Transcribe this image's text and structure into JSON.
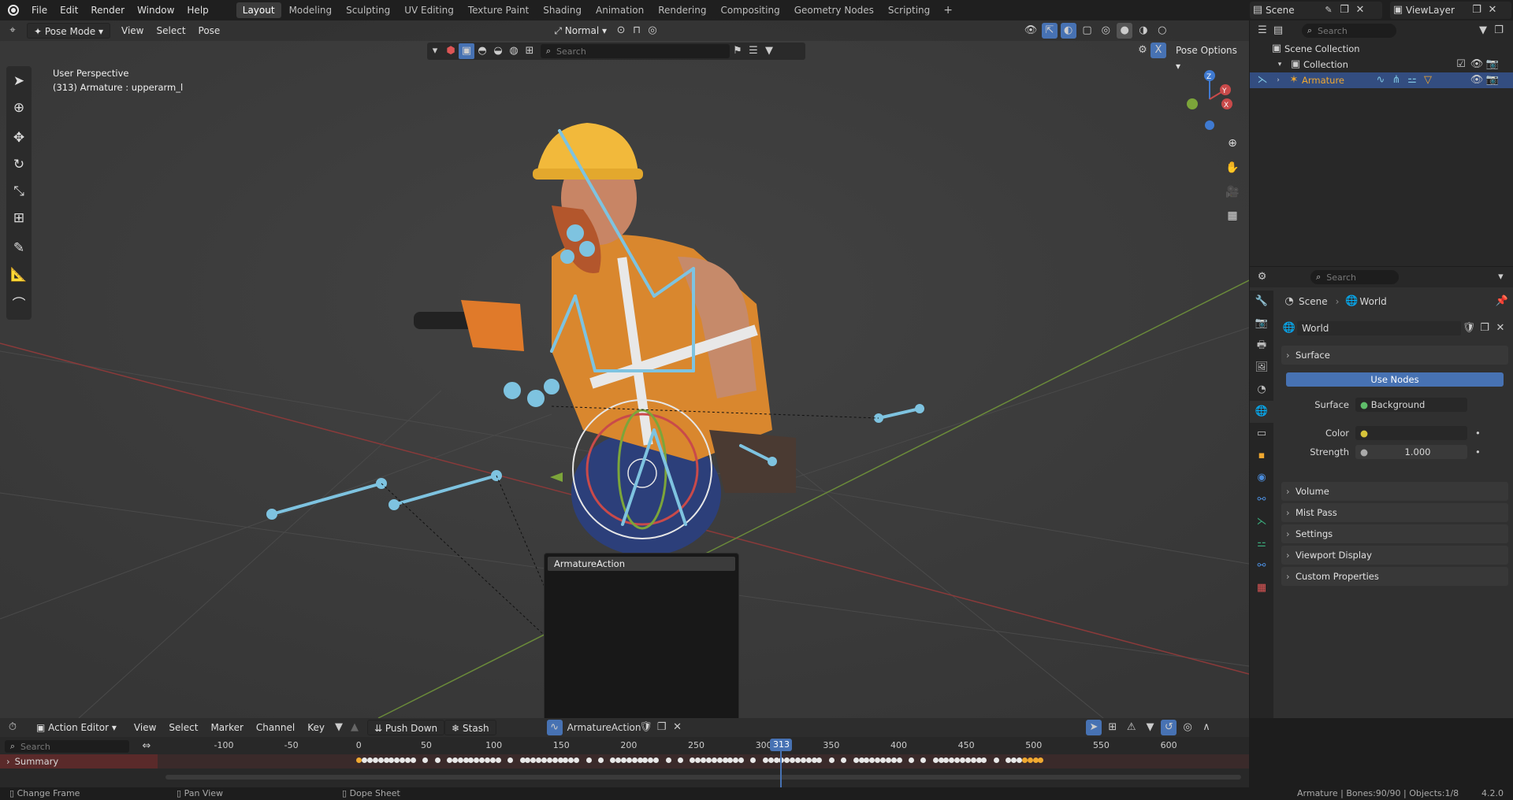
{
  "menu": {
    "file": "File",
    "edit": "Edit",
    "render": "Render",
    "window": "Window",
    "help": "Help"
  },
  "workspaces": [
    "Layout",
    "Modeling",
    "Sculpting",
    "UV Editing",
    "Texture Paint",
    "Shading",
    "Animation",
    "Rendering",
    "Compositing",
    "Geometry Nodes",
    "Scripting"
  ],
  "scene_name": "Scene",
  "viewlayer_name": "ViewLayer",
  "viewport": {
    "mode": "Pose Mode",
    "menus": [
      "View",
      "Select",
      "Pose"
    ],
    "orientation": "Normal",
    "search_placeholder": "Search",
    "pose_options": "Pose Options",
    "overlay_line1": "User Perspective",
    "overlay_line2": "(313) Armature : upperarm_l"
  },
  "popup": {
    "action_item": "ArmatureAction"
  },
  "outliner": {
    "search_placeholder": "Search",
    "scene_collection": "Scene Collection",
    "collection": "Collection",
    "armature": "Armature"
  },
  "properties": {
    "search_placeholder": "Search",
    "breadcrumb_scene": "Scene",
    "breadcrumb_world": "World",
    "world_name": "World",
    "surface_panel": "Surface",
    "use_nodes": "Use Nodes",
    "surface_label": "Surface",
    "surface_value": "Background",
    "color_label": "Color",
    "strength_label": "Strength",
    "strength_value": "1.000",
    "panels": [
      "Volume",
      "Mist Pass",
      "Settings",
      "Viewport Display",
      "Custom Properties"
    ]
  },
  "timeline": {
    "editor": "Action Editor",
    "menus": [
      "View",
      "Select",
      "Marker",
      "Channel",
      "Key"
    ],
    "push_down": "Push Down",
    "stash": "Stash",
    "action_name": "ArmatureAction",
    "search_placeholder": "Search",
    "summary": "Summary",
    "current_frame": "313",
    "ticks": [
      "-100",
      "-50",
      "0",
      "50",
      "100",
      "150",
      "200",
      "250",
      "300",
      "350",
      "400",
      "450",
      "500",
      "550",
      "600"
    ]
  },
  "status": {
    "change_frame": "Change Frame",
    "pan_view": "Pan View",
    "dope_sheet": "Dope Sheet",
    "info": "Armature | Bones:90/90 | Objects:1/8",
    "version": "4.2.0"
  },
  "colors": {
    "accent": "#4772b3",
    "bone": "#7ec3e0",
    "x_axis": "#c94a4a",
    "y_axis": "#7ca53a",
    "z_axis": "#3f7ad1",
    "keyframe": "#e8e8e8",
    "keyframe_selected": "#f0a830"
  }
}
